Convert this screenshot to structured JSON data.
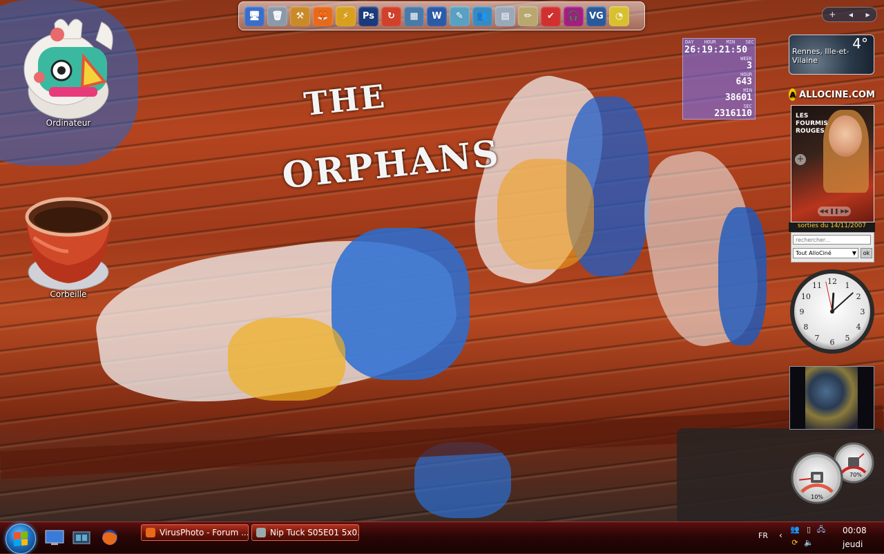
{
  "desktop": {
    "icons": [
      {
        "label": "Ordinateur",
        "icon": "computer-icon"
      },
      {
        "label": "Corbeille",
        "icon": "recycle-bin-icon"
      }
    ],
    "wallpaper_text": [
      "THE",
      "ORPHANS"
    ]
  },
  "dock": {
    "items": [
      {
        "name": "desktop-icon",
        "glyph": "🖥",
        "color": "#3a6ec9"
      },
      {
        "name": "recycle-bin-icon",
        "glyph": "🗑",
        "color": "#8a9aaa"
      },
      {
        "name": "tools-icon",
        "glyph": "⚒",
        "color": "#c98a2a"
      },
      {
        "name": "firefox-icon",
        "glyph": "🦊",
        "color": "#e66a1a"
      },
      {
        "name": "lightning-icon",
        "glyph": "⚡",
        "color": "#d9a020"
      },
      {
        "name": "photoshop-icon",
        "glyph": "Ps",
        "color": "#1c3a7a"
      },
      {
        "name": "sync-icon",
        "glyph": "↻",
        "color": "#d0402a"
      },
      {
        "name": "window-icon",
        "glyph": "▦",
        "color": "#4a7aa8"
      },
      {
        "name": "word-icon",
        "glyph": "W",
        "color": "#2a5aa8"
      },
      {
        "name": "notes-icon",
        "glyph": "✎",
        "color": "#5aa0c0"
      },
      {
        "name": "contacts-icon",
        "glyph": "👥",
        "color": "#3a8ac0"
      },
      {
        "name": "calculator-icon",
        "glyph": "▤",
        "color": "#9aa8b8"
      },
      {
        "name": "pencils-icon",
        "glyph": "✏",
        "color": "#b8a870"
      },
      {
        "name": "checklist-icon",
        "glyph": "✔",
        "color": "#d03030"
      },
      {
        "name": "headphones-icon",
        "glyph": "🎧",
        "color": "#a02080"
      },
      {
        "name": "vg-icon",
        "glyph": "VG",
        "color": "#2a5a9a"
      },
      {
        "name": "clock-icon",
        "glyph": "◔",
        "color": "#d8c030"
      }
    ]
  },
  "countdown": {
    "headers": [
      "DAY",
      "HOUR",
      "MIN",
      "SEC"
    ],
    "main": "26:19:21:50",
    "rows": [
      {
        "label": "WEEK",
        "value": "3"
      },
      {
        "label": "HOUR",
        "value": "643"
      },
      {
        "label": "MIN",
        "value": "38601"
      },
      {
        "label": "SEC",
        "value": "2316110"
      }
    ]
  },
  "sidebar": {
    "toolbar": {
      "add": "+",
      "prev": "◀",
      "next": "▶"
    },
    "weather": {
      "temperature": "4°",
      "city": "Rennes, Ille-et-Vilaine"
    },
    "allocine": {
      "brand": "ALLOCINE.COM",
      "poster_title": "LES FOURMIS ROUGES",
      "release": "sorties du 14/11/2007",
      "search_placeholder": "rechercher...",
      "select_value": "Tout AlloCiné",
      "ok": "ok"
    },
    "clock": {
      "numbers": [
        "12",
        "1",
        "2",
        "3",
        "4",
        "5",
        "6",
        "7",
        "8",
        "9",
        "10",
        "11"
      ],
      "hour": 0,
      "minute": 8
    },
    "meters": {
      "cpu_percent": 10,
      "memory_percent": 70,
      "cpu_label": "10%",
      "memory_label": "70%"
    }
  },
  "taskbar": {
    "tasks": [
      {
        "label": "VirusPhoto - Forum ...",
        "icon": "firefox-icon",
        "color": "#e66a1a"
      },
      {
        "label": "Nip Tuck S05E01 5x0...",
        "icon": "media-icon",
        "color": "#9aa"
      }
    ],
    "quick_launch": [
      "show-desktop-icon",
      "switch-windows-icon",
      "firefox-icon"
    ],
    "language": "FR",
    "tray_arrow": "‹",
    "time": "00:08",
    "day": "jeudi"
  },
  "colors": {
    "taskbar": "#2a0606",
    "accent": "#e46a4a"
  }
}
